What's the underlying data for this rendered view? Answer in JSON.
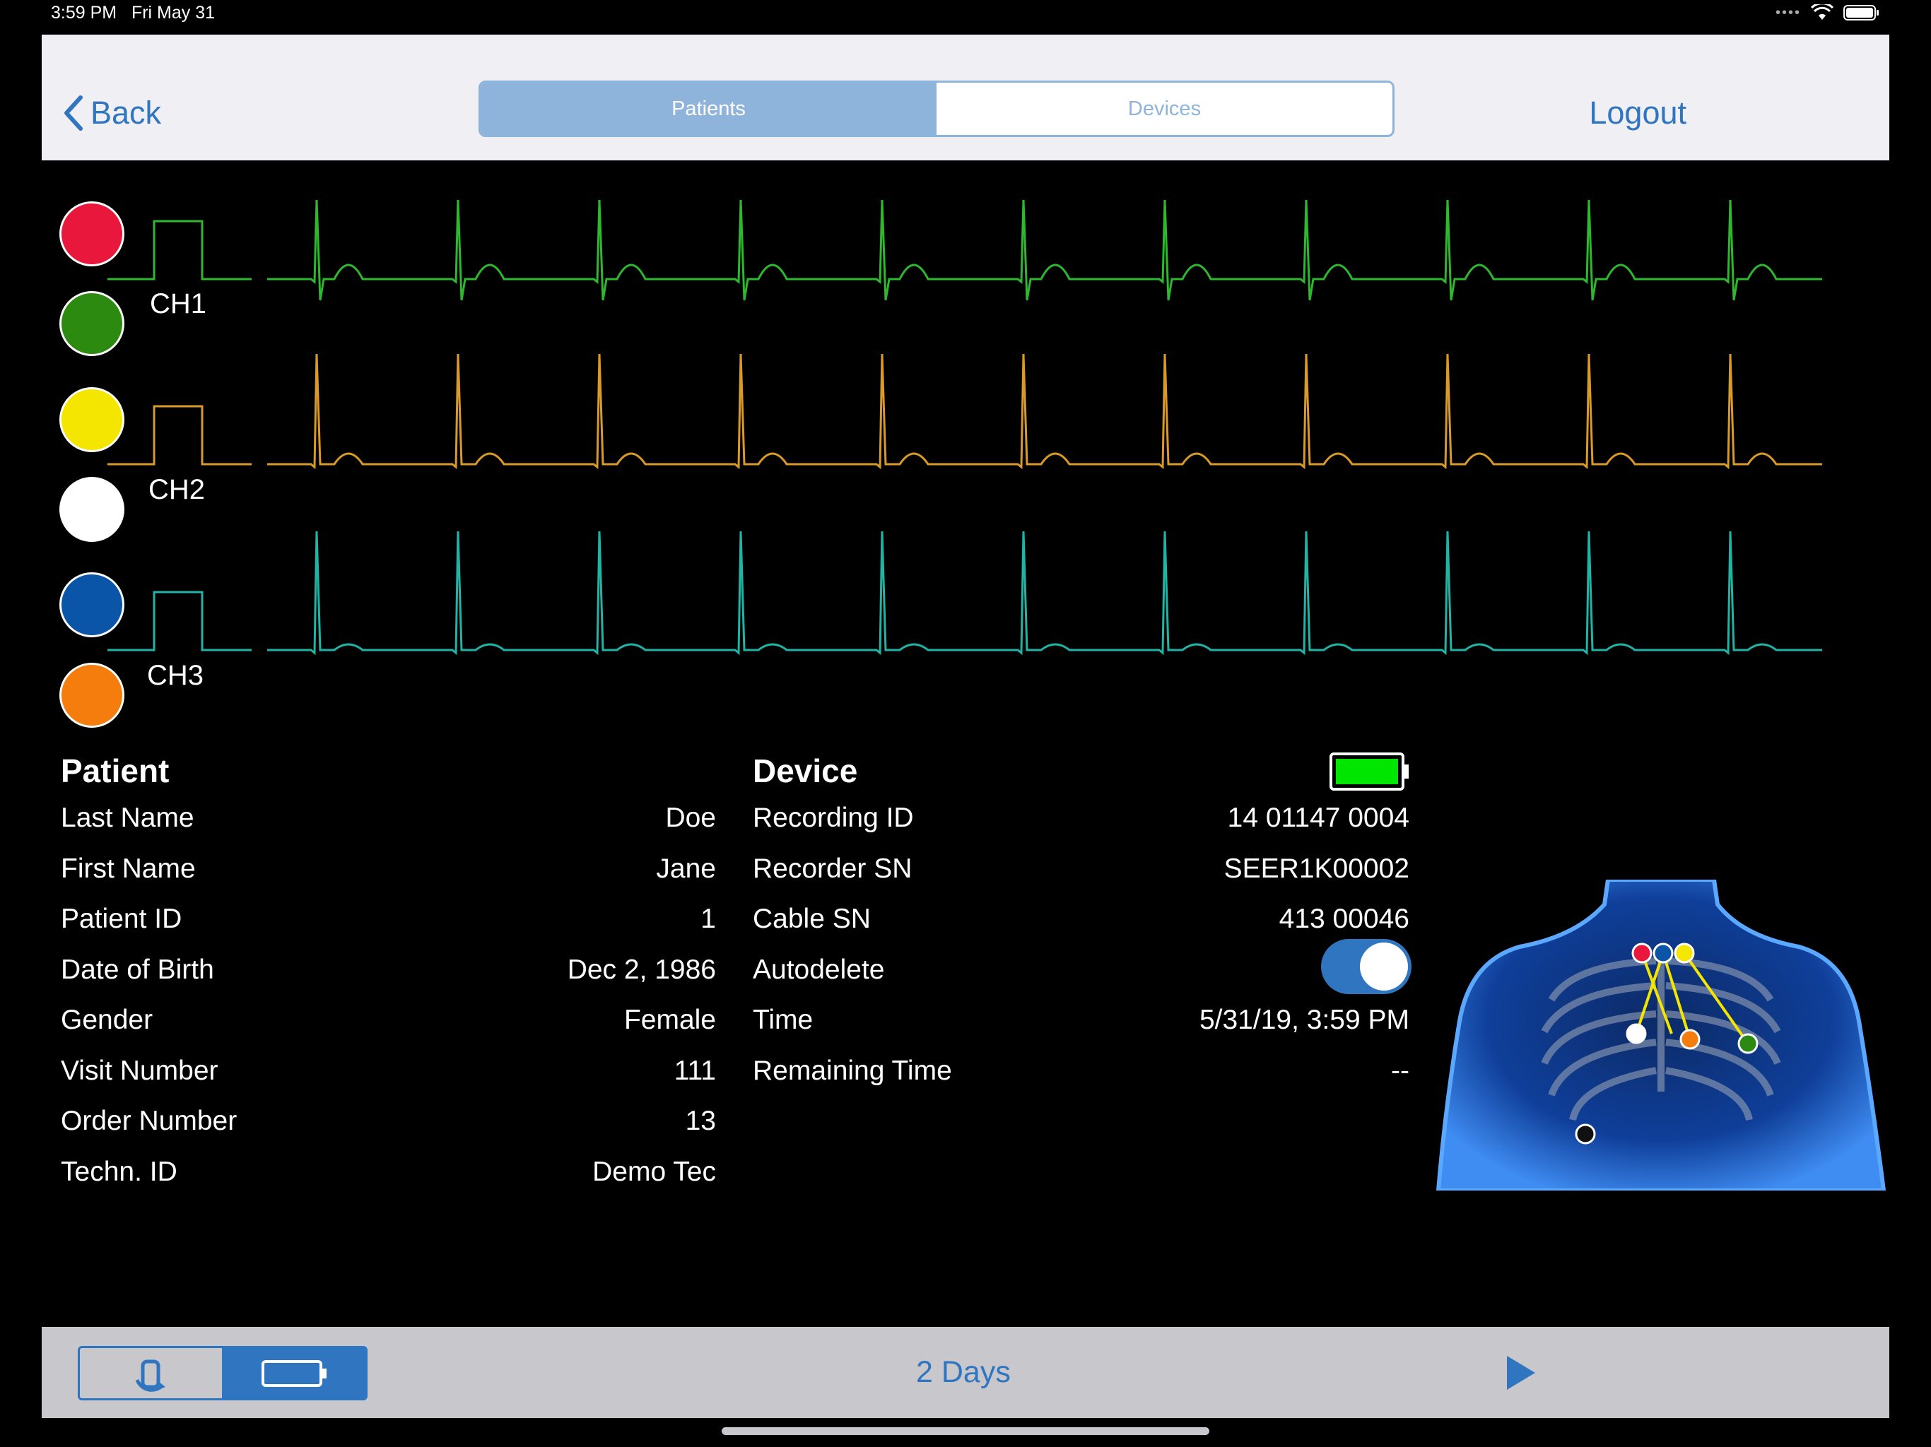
{
  "status_bar": {
    "time": "3:59 PM",
    "date": "Fri May 31"
  },
  "nav": {
    "back_label": "Back",
    "tabs": [
      {
        "label": "Patients",
        "active": true
      },
      {
        "label": "Devices",
        "active": false
      }
    ],
    "logout_label": "Logout"
  },
  "channels": [
    {
      "label": "CH1",
      "color": "#2db82d",
      "electrodes": [
        "#e8173b",
        "#2b8a0f"
      ]
    },
    {
      "label": "CH2",
      "color": "#d99a28",
      "electrodes": [
        "#f5e600",
        "#ffffff"
      ]
    },
    {
      "label": "CH3",
      "color": "#1fb5a6",
      "electrodes": [
        "#0a55a8",
        "#f47d0d"
      ]
    }
  ],
  "patient": {
    "title": "Patient",
    "rows": [
      {
        "label": "Last Name",
        "value": "Doe"
      },
      {
        "label": "First Name",
        "value": "Jane"
      },
      {
        "label": "Patient ID",
        "value": "1"
      },
      {
        "label": "Date of Birth",
        "value": "Dec 2, 1986"
      },
      {
        "label": "Gender",
        "value": "Female"
      },
      {
        "label": "Visit Number",
        "value": "111"
      },
      {
        "label": "Order Number",
        "value": "13"
      },
      {
        "label": "Techn. ID",
        "value": "Demo Tec"
      }
    ]
  },
  "device": {
    "title": "Device",
    "battery_color": "#00e600",
    "rows": [
      {
        "label": "Recording ID",
        "value": "14 01147 0004"
      },
      {
        "label": "Recorder SN",
        "value": "SEER1K00002"
      },
      {
        "label": "Cable SN",
        "value": "413 00046"
      },
      {
        "label": "Autodelete",
        "value": ""
      },
      {
        "label": "Time",
        "value": "5/31/19, 3:59 PM"
      },
      {
        "label": "Remaining Time",
        "value": "--"
      }
    ],
    "autodelete_on": true
  },
  "footer": {
    "duration": "2 Days"
  },
  "colors": {
    "accent": "#2f75c0",
    "segment": "#8fb4dc"
  }
}
